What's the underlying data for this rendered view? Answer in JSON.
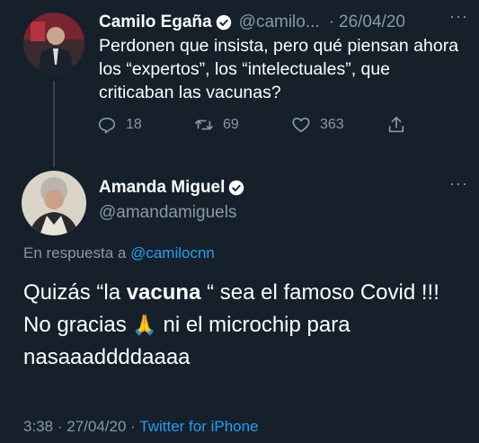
{
  "colors": {
    "background": "#15202b",
    "muted": "#8899a6",
    "accent": "#1da1f2",
    "text": "#ffffff"
  },
  "parent_tweet": {
    "display_name": "Camilo Egaña",
    "handle": "@camilo...",
    "separator": "·",
    "date": "26/04/20",
    "text": "Perdonen que insista, pero qué piensan ahora los “expertos”, los “intelectuales”, que criticaban las vacunas?",
    "replies": "18",
    "retweets": "69",
    "likes": "363",
    "icons": [
      "reply-icon",
      "retweet-icon",
      "like-icon",
      "share-icon",
      "more-icon",
      "verified-icon"
    ]
  },
  "main_tweet": {
    "display_name": "Amanda Miguel",
    "handle": "@amandamiguels",
    "reply_prefix": "En respuesta a",
    "reply_to": "@camilocnn",
    "text_part1": "Quizás “la ",
    "text_bold": "vacuna",
    "text_part2": " “ sea el famoso Covid !!! No gracias",
    "emoji": "🙏",
    "text_part3": " ni el microchip para nasaaaddddaaaa",
    "time": "3:38",
    "separator": "·",
    "date": "27/04/20",
    "source_separator": "·",
    "source": "Twitter for iPhone",
    "icons": [
      "more-icon",
      "verified-icon"
    ]
  }
}
